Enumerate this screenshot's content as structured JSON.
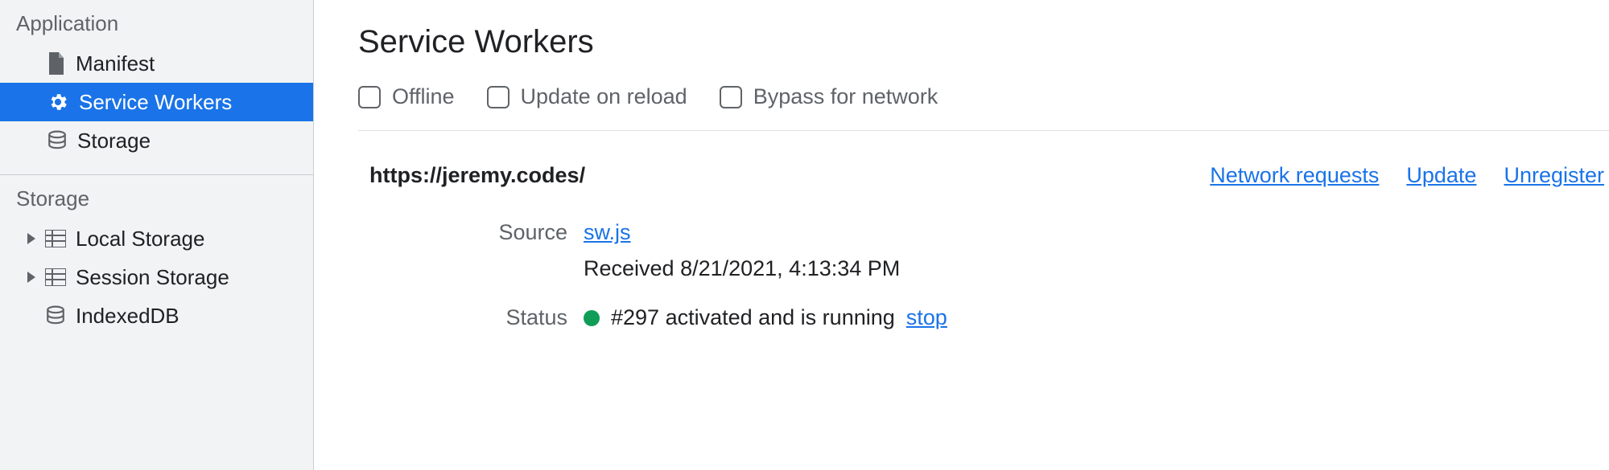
{
  "sidebar": {
    "sections": {
      "application": {
        "title": "Application",
        "items": [
          {
            "label": "Manifest"
          },
          {
            "label": "Service Workers"
          },
          {
            "label": "Storage"
          }
        ]
      },
      "storage": {
        "title": "Storage",
        "items": [
          {
            "label": "Local Storage"
          },
          {
            "label": "Session Storage"
          },
          {
            "label": "IndexedDB"
          }
        ]
      }
    }
  },
  "main": {
    "title": "Service Workers",
    "options": {
      "offline": "Offline",
      "update_on_reload": "Update on reload",
      "bypass_for_network": "Bypass for network"
    },
    "origin": "https://jeremy.codes/",
    "links": {
      "network_requests": "Network requests",
      "update": "Update",
      "unregister": "Unregister"
    },
    "details": {
      "source_label": "Source",
      "source_file": "sw.js",
      "received": "Received 8/21/2021, 4:13:34 PM",
      "status_label": "Status",
      "status_text": "#297 activated and is running",
      "status_action": "stop",
      "status_color": "#0f9d58"
    }
  }
}
